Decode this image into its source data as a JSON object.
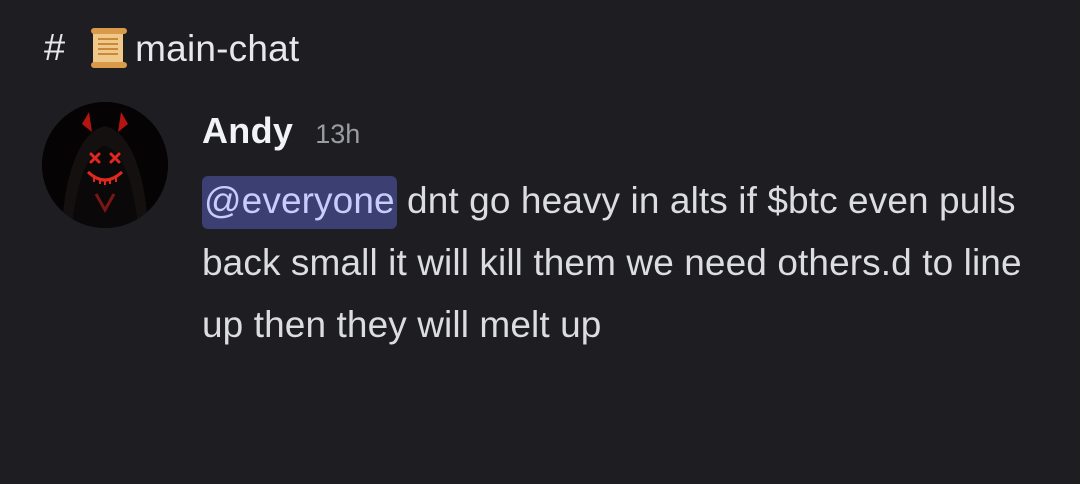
{
  "channel": {
    "hash": "#",
    "icon": "scroll-icon",
    "name": "main-chat"
  },
  "message": {
    "author": "Andy",
    "timestamp": "13h",
    "mention": "@everyone",
    "text": " dnt go heavy in alts if $btc even pulls back small it will kill them we need others.d to line up then they will melt up"
  },
  "colors": {
    "background": "#1d1d22",
    "mention_bg": "#3b3f71",
    "mention_text": "#c9cdfb",
    "text": "#dbdde1",
    "timestamp": "#9a9ca3"
  }
}
